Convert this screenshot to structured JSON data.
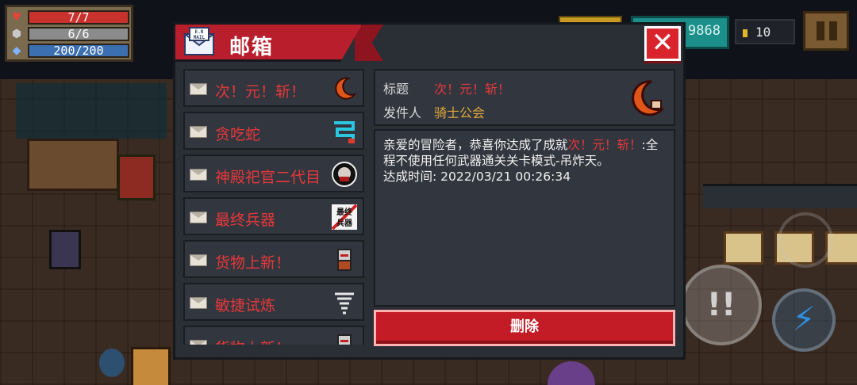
{
  "hud": {
    "hp": "7/7",
    "armor": "6/6",
    "energy": "200/200",
    "gems": "9868",
    "coins": "10"
  },
  "mailbox": {
    "title": "邮箱",
    "mail_icon_text": "E.R\nMAIL",
    "close_label": "✕",
    "mails": [
      {
        "subject": "次！元！斩！",
        "icon": "crescent-blade-icon"
      },
      {
        "subject": "贪吃蛇",
        "icon": "snake-icon"
      },
      {
        "subject": "神殿祀官二代目",
        "icon": "priest-portrait-icon"
      },
      {
        "subject": "最终兵器",
        "icon": "ultimate-weapon-icon",
        "icon_text": "最终\n兵器"
      },
      {
        "subject": "货物上新！",
        "icon": "merchant-icon"
      },
      {
        "subject": "敏捷试炼",
        "icon": "tornado-icon"
      },
      {
        "subject": "货物上新！",
        "icon": "merchant-icon"
      }
    ],
    "detail": {
      "title_label": "标题",
      "title_value": "次！元！斩！",
      "sender_label": "发件人",
      "sender_value": "骑士公会",
      "body_prefix": "亲爱的冒险者，恭喜你达成了成就",
      "body_achievement": "次！元！斩！",
      "body_suffix": ":全程不使用任何武器通关关卡模式-吊炸天。",
      "time_label": "达成时间:",
      "time_value": "2022/03/21 00:26:34"
    },
    "delete_label": "删除"
  },
  "colors": {
    "accent_red": "#c41c27",
    "mail_red_text": "#e8383a",
    "sender_gold": "#e0a63a"
  }
}
